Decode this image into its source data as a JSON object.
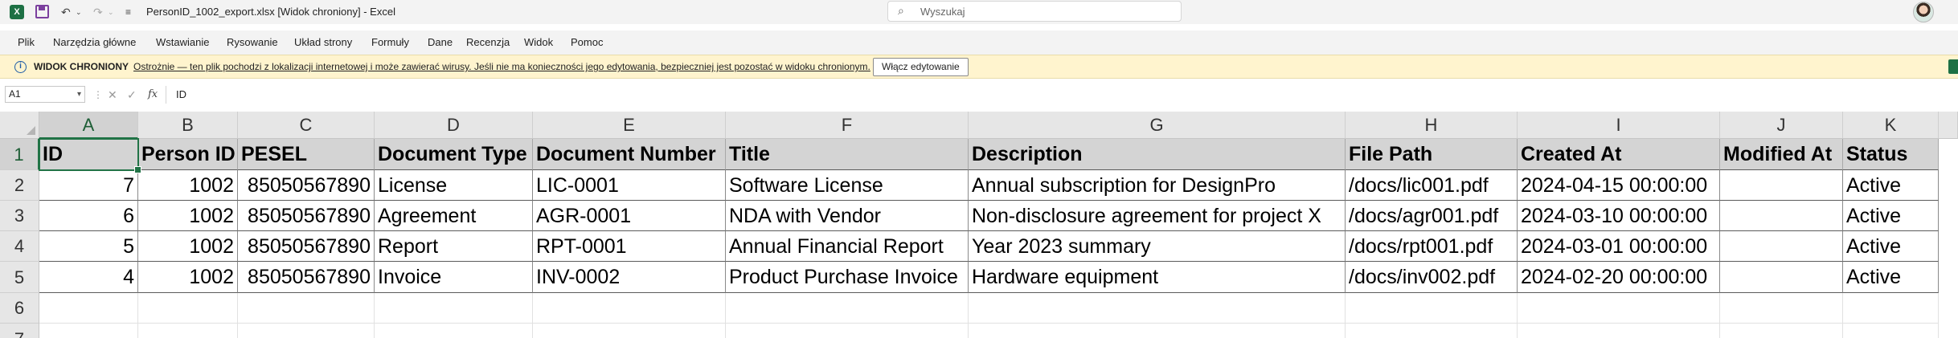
{
  "titlebar": {
    "title": "PersonID_1002_export.xlsx  [Widok chroniony]  -  Excel",
    "search_placeholder": "Wyszukaj"
  },
  "menu": [
    "Plik",
    "Narzędzia główne",
    "Wstawianie",
    "Rysowanie",
    "Układ strony",
    "Formuły",
    "Dane",
    "Recenzja",
    "Widok",
    "Pomoc"
  ],
  "protected_view": {
    "title": "WIDOK CHRONIONY",
    "message": "Ostrożnie — ten plik pochodzi z lokalizacji internetowej i może zawierać wirusy. Jeśli nie ma konieczności jego edytowania, bezpieczniej jest pozostać w widoku chronionym.",
    "button": "Włącz edytowanie"
  },
  "formula_bar": {
    "name_box": "A1",
    "fx_label": "fx",
    "value": "ID"
  },
  "sheet": {
    "column_letters": [
      "A",
      "B",
      "C",
      "D",
      "E",
      "F",
      "G",
      "H",
      "I",
      "J",
      "K"
    ],
    "row_numbers": [
      "1",
      "2",
      "3",
      "4",
      "5",
      "6",
      "7"
    ],
    "active_cell": "A1",
    "header": [
      "ID",
      "Person ID",
      "PESEL",
      "Document Type",
      "Document Number",
      "Title",
      "Description",
      "File Path",
      "Created At",
      "Modified At",
      "Status"
    ],
    "rows": [
      [
        "7",
        "1002",
        "85050567890",
        "License",
        "LIC-0001",
        "Software License",
        "Annual subscription for DesignPro",
        "/docs/lic001.pdf",
        "2024-04-15 00:00:00",
        "",
        "Active"
      ],
      [
        "6",
        "1002",
        "85050567890",
        "Agreement",
        "AGR-0001",
        "NDA with Vendor",
        "Non-disclosure agreement for project X",
        "/docs/agr001.pdf",
        "2024-03-10 00:00:00",
        "",
        "Active"
      ],
      [
        "5",
        "1002",
        "85050567890",
        "Report",
        "RPT-0001",
        "Annual Financial Report",
        "Year 2023 summary",
        "/docs/rpt001.pdf",
        "2024-03-01 00:00:00",
        "",
        "Active"
      ],
      [
        "4",
        "1002",
        "85050567890",
        "Invoice",
        "INV-0002",
        "Product Purchase Invoice",
        "Hardware equipment",
        "/docs/inv002.pdf",
        "2024-02-20 00:00:00",
        "",
        "Active"
      ]
    ]
  },
  "colors": {
    "accent": "#217346",
    "protected_bar": "#fff4ce",
    "header_fill": "#d4d4d4"
  }
}
